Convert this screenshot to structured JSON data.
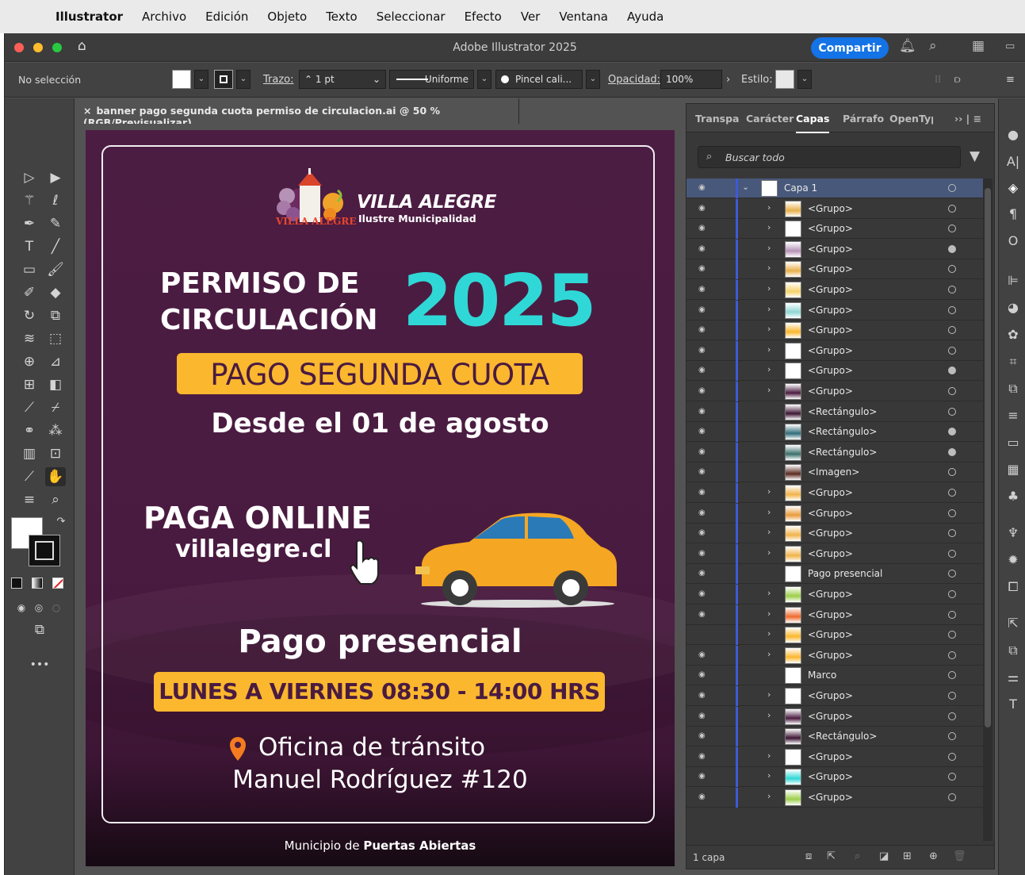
{
  "menubar": {
    "items": [
      "Illustrator",
      "Archivo",
      "Edición",
      "Objeto",
      "Texto",
      "Seleccionar",
      "Efecto",
      "Ver",
      "Ventana",
      "Ayuda"
    ]
  },
  "titlebar": {
    "title": "Adobe Illustrator 2025",
    "share_label": "Compartir"
  },
  "control": {
    "selection": "No selección",
    "stroke_label": "Trazo:",
    "stroke_value": "1 pt",
    "profile": "Uniforme",
    "brush": "Pincel cali...",
    "opacity_label": "Opacidad:",
    "opacity_value": "100%",
    "style_label": "Estilo:"
  },
  "document": {
    "tab_title": "banner pago segunda cuota permiso de circulacion.ai @ 50 % (RGB/Previsualizar)"
  },
  "artboard": {
    "logo_title": "VILLA ALEGRE",
    "logo_subtitle": "Ilustre Municipalidad",
    "logo_stamp": "VILLA ALEGRE",
    "permiso_line1": "PERMISO DE",
    "permiso_line2": "CIRCULACIÓN",
    "year": "2025",
    "pago_cuota": "PAGO SEGUNDA CUOTA",
    "desde": "Desde el 01 de agosto",
    "paga_online": "PAGA ONLINE",
    "website": "villalegre.cl",
    "presencial_title": "Pago presencial",
    "schedule": "LUNES  A  VIERNES 08:30 - 14:00 HRS",
    "office_line1": "Oficina de tránsito",
    "office_line2": "Manuel Rodríguez #120",
    "footer_prefix": "Municipio de ",
    "footer_bold": "Puertas Abiertas"
  },
  "panel": {
    "tabs": [
      "Transpa",
      "Carácter",
      "Capas",
      "Párrafo",
      "OpenTyp"
    ],
    "active_tab": "Capas",
    "search_placeholder": "Buscar todo",
    "layer_count": "1 capa",
    "layers": [
      {
        "name": "Capa 1",
        "level": 0,
        "expanded": true,
        "target": "open"
      },
      {
        "name": "<Grupo>",
        "level": 1,
        "target": "open"
      },
      {
        "name": "<Grupo>",
        "level": 1,
        "target": "open"
      },
      {
        "name": "<Grupo>",
        "level": 1,
        "target": "filled"
      },
      {
        "name": "<Grupo>",
        "level": 1,
        "target": "open"
      },
      {
        "name": "<Grupo>",
        "level": 1,
        "target": "open"
      },
      {
        "name": "<Grupo>",
        "level": 1,
        "target": "open"
      },
      {
        "name": "<Grupo>",
        "level": 1,
        "target": "open"
      },
      {
        "name": "<Grupo>",
        "level": 1,
        "target": "open"
      },
      {
        "name": "<Grupo>",
        "level": 1,
        "target": "filled"
      },
      {
        "name": "<Grupo>",
        "level": 1,
        "target": "open"
      },
      {
        "name": "<Rectángulo>",
        "level": 1,
        "leaf": true,
        "target": "open"
      },
      {
        "name": "<Rectángulo>",
        "level": 1,
        "leaf": true,
        "target": "filled"
      },
      {
        "name": "<Rectángulo>",
        "level": 1,
        "leaf": true,
        "target": "filled"
      },
      {
        "name": "<Imagen>",
        "level": 1,
        "leaf": true,
        "target": "open"
      },
      {
        "name": "<Grupo>",
        "level": 1,
        "target": "open"
      },
      {
        "name": "<Grupo>",
        "level": 1,
        "target": "open"
      },
      {
        "name": "<Grupo>",
        "level": 1,
        "target": "open"
      },
      {
        "name": "<Grupo>",
        "level": 1,
        "target": "open"
      },
      {
        "name": "Pago presencial",
        "level": 1,
        "leaf": true,
        "target": "open"
      },
      {
        "name": "<Grupo>",
        "level": 1,
        "target": "open"
      },
      {
        "name": "<Grupo>",
        "level": 1,
        "target": "open"
      },
      {
        "name": "<Grupo>",
        "level": 1,
        "target": "open",
        "hidden": true
      },
      {
        "name": "<Grupo>",
        "level": 1,
        "target": "open"
      },
      {
        "name": "Marco",
        "level": 1,
        "leaf": true,
        "target": "open"
      },
      {
        "name": "<Grupo>",
        "level": 1,
        "target": "open"
      },
      {
        "name": "<Grupo>",
        "level": 1,
        "target": "open"
      },
      {
        "name": "<Rectángulo>",
        "level": 1,
        "leaf": true,
        "target": "open"
      },
      {
        "name": "<Grupo>",
        "level": 1,
        "target": "open"
      },
      {
        "name": "<Grupo>",
        "level": 1,
        "target": "open"
      },
      {
        "name": "<Grupo>",
        "level": 1,
        "target": "open"
      }
    ]
  },
  "colors": {
    "accent_blue": "#1473e6",
    "artboard_purple": "#4c1d43",
    "year_cyan": "#2fd8d6",
    "banner_yellow": "#fbb72e",
    "pin_orange": "#f47b20",
    "layer_color_bar": "#3e5ad6"
  }
}
